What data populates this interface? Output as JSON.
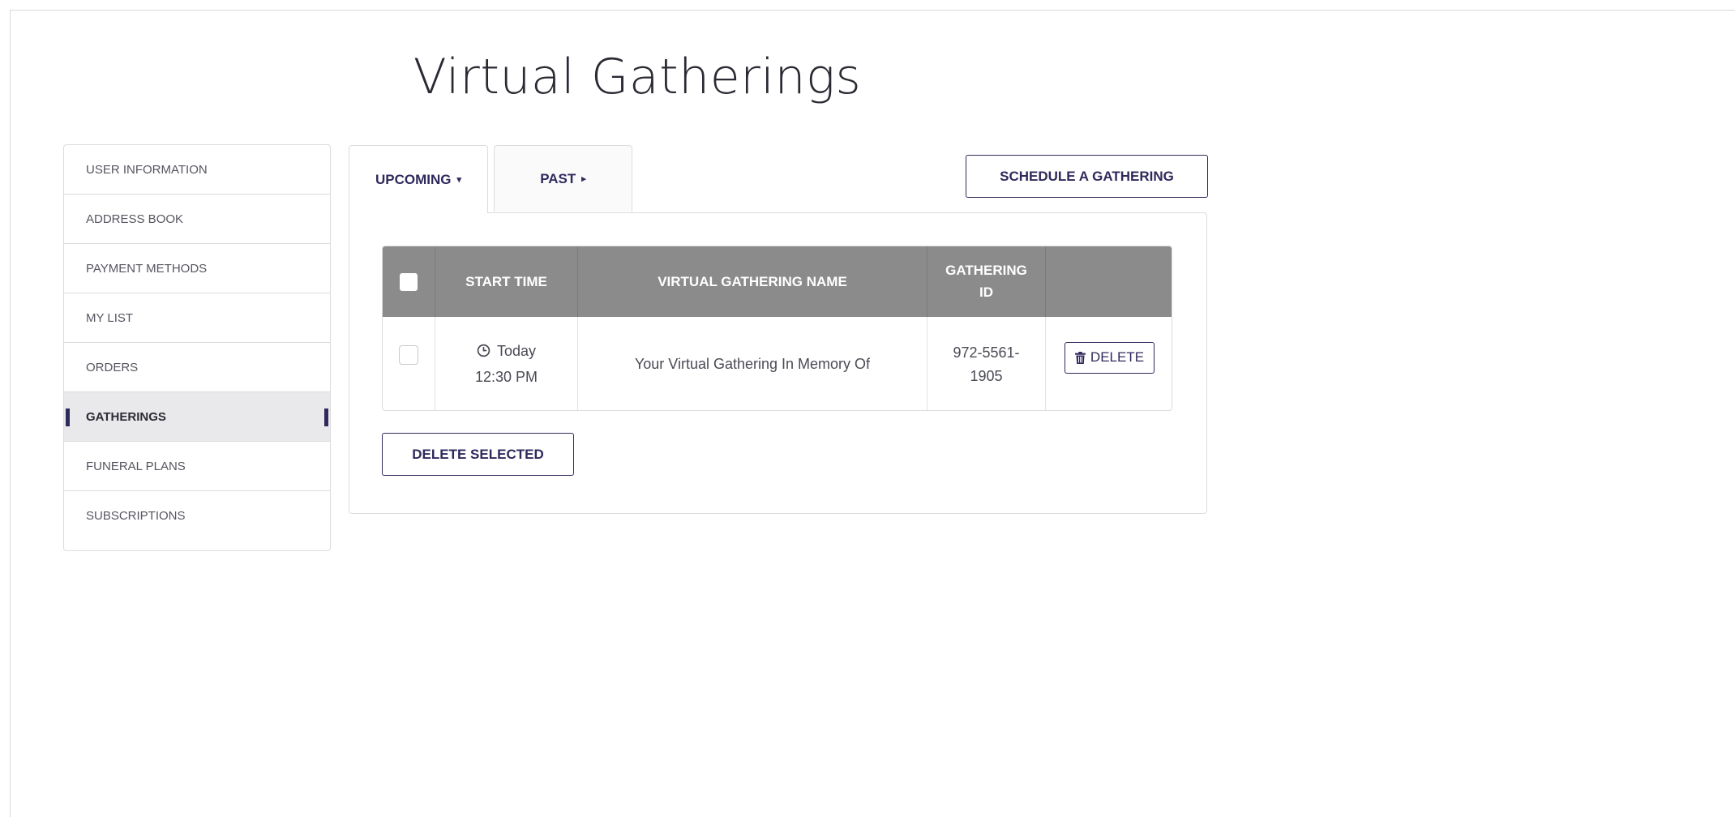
{
  "page": {
    "title": "Virtual Gatherings"
  },
  "sidebar": {
    "items": [
      {
        "label": "USER INFORMATION",
        "active": false
      },
      {
        "label": "ADDRESS BOOK",
        "active": false
      },
      {
        "label": "PAYMENT METHODS",
        "active": false
      },
      {
        "label": "MY LIST",
        "active": false
      },
      {
        "label": "ORDERS",
        "active": false
      },
      {
        "label": "GATHERINGS",
        "active": true
      },
      {
        "label": "FUNERAL PLANS",
        "active": false
      },
      {
        "label": "SUBSCRIPTIONS",
        "active": false
      }
    ]
  },
  "tabs": {
    "upcoming": {
      "label": "UPCOMING",
      "caret": "▾"
    },
    "past": {
      "label": "PAST",
      "caret": "▸"
    }
  },
  "actions": {
    "schedule_label": "SCHEDULE A GATHERING",
    "delete_selected_label": "DELETE SELECTED"
  },
  "table": {
    "headers": {
      "start_time": "START TIME",
      "name": "VIRTUAL GATHERING NAME",
      "gathering_id_line1": "GATHERING",
      "gathering_id_line2": "ID"
    },
    "rows": [
      {
        "day": "Today",
        "time": "12:30 PM",
        "name": "Your Virtual Gathering In Memory Of",
        "gathering_id_line1": "972-5561-",
        "gathering_id_line2": "1905",
        "delete_label": "DELETE"
      }
    ]
  },
  "colors": {
    "accent": "#2f2a5c",
    "table_header_bg": "#8b8b8b",
    "active_sidebar_bg": "#e9e9ec"
  },
  "icons": {
    "clock": "clock-icon",
    "trash": "trash-icon"
  }
}
